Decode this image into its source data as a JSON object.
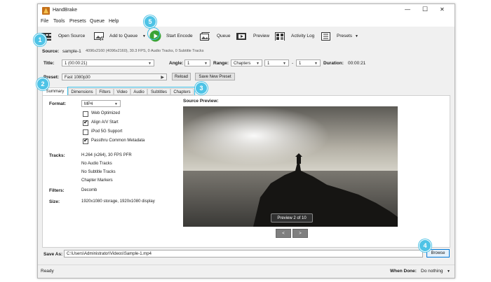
{
  "window": {
    "title": "HandBrake",
    "controls": {
      "minimize": "—",
      "maximize": "☐",
      "close": "✕"
    }
  },
  "menu": [
    "File",
    "Tools",
    "Presets",
    "Queue",
    "Help"
  ],
  "toolbar": {
    "open_source": "Open Source",
    "add_to_queue": "Add to Queue",
    "start_encode": "Start Encode",
    "queue": "Queue",
    "preview": "Preview",
    "activity_log": "Activity Log",
    "presets": "Presets"
  },
  "source": {
    "label": "Source:",
    "name": "sample-1",
    "info": "4096x2160 (4096x2160), 30.3 FPS, 0 Audio Tracks, 0 Subtitle Tracks"
  },
  "title_row": {
    "title_label": "Title:",
    "title_value": "1 (00:00:21)",
    "angle_label": "Angle:",
    "angle_value": "1",
    "range_label": "Range:",
    "range_value": "Chapters",
    "range_start": "1",
    "range_sep": "-",
    "range_end": "1",
    "duration_label": "Duration:",
    "duration_value": "00:00:21"
  },
  "preset_row": {
    "label": "Preset:",
    "value": "Fast 1080p30",
    "reload": "Reload",
    "save_new": "Save New Preset"
  },
  "tabs": [
    "Summary",
    "Dimensions",
    "Filters",
    "Video",
    "Audio",
    "Subtitles",
    "Chapters"
  ],
  "summary": {
    "format_label": "Format:",
    "format_value": "MP4",
    "options": [
      {
        "label": "Web Optimized",
        "checked": false
      },
      {
        "label": "Align A/V Start",
        "checked": true
      },
      {
        "label": "iPod 5G Support",
        "checked": false
      },
      {
        "label": "Passthru Common Metadata",
        "checked": true
      }
    ],
    "tracks_label": "Tracks:",
    "tracks": [
      "H.264 (x264), 30 FPS PFR",
      "No Audio Tracks",
      "No Subtitle Tracks",
      "Chapter Markers"
    ],
    "filters_label": "Filters:",
    "filters_value": "Decomb",
    "size_label": "Size:",
    "size_value": "1920x1080 storage, 1920x1080 display"
  },
  "preview": {
    "label": "Source Preview:",
    "badge": "Preview 2 of 10",
    "prev": "<",
    "next": ">"
  },
  "save": {
    "label": "Save As:",
    "path": "C:\\Users\\Administrator\\Videos\\Sample-1.mp4",
    "browse": "Browse"
  },
  "status": {
    "text": "Ready",
    "when_done_label": "When Done:",
    "when_done_value": "Do nothing"
  },
  "markers": [
    "1",
    "2",
    "3",
    "4",
    "5"
  ],
  "colors": {
    "marker": "#4ec3e6",
    "start_encode": "#3aa335",
    "accent": "#3cc0e8"
  }
}
